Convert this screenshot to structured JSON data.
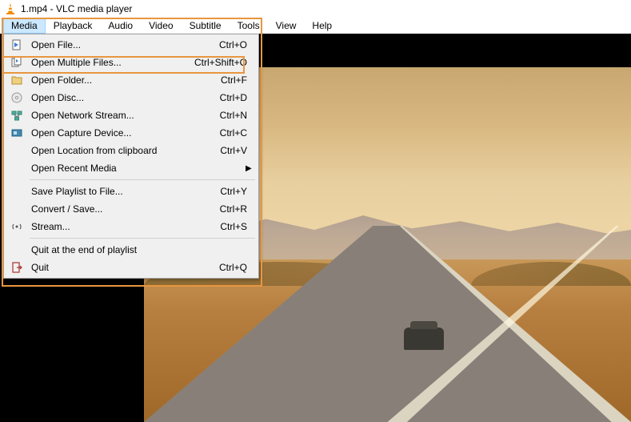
{
  "titlebar": {
    "text": "1.mp4 - VLC media player"
  },
  "menubar": {
    "items": [
      {
        "label": "Media",
        "active": true
      },
      {
        "label": "Playback"
      },
      {
        "label": "Audio"
      },
      {
        "label": "Video"
      },
      {
        "label": "Subtitle"
      },
      {
        "label": "Tools"
      },
      {
        "label": "View"
      },
      {
        "label": "Help"
      }
    ]
  },
  "dropdown": {
    "groups": [
      [
        {
          "icon": "file-icon",
          "label": "Open File...",
          "shortcut": "Ctrl+O"
        },
        {
          "icon": "files-icon",
          "label": "Open Multiple Files...",
          "shortcut": "Ctrl+Shift+O",
          "highlighted": true
        },
        {
          "icon": "folder-icon",
          "label": "Open Folder...",
          "shortcut": "Ctrl+F"
        },
        {
          "icon": "disc-icon",
          "label": "Open Disc...",
          "shortcut": "Ctrl+D"
        },
        {
          "icon": "network-icon",
          "label": "Open Network Stream...",
          "shortcut": "Ctrl+N"
        },
        {
          "icon": "capture-icon",
          "label": "Open Capture Device...",
          "shortcut": "Ctrl+C"
        },
        {
          "icon": "",
          "label": "Open Location from clipboard",
          "shortcut": "Ctrl+V"
        },
        {
          "icon": "",
          "label": "Open Recent Media",
          "submenu": true
        }
      ],
      [
        {
          "icon": "",
          "label": "Save Playlist to File...",
          "shortcut": "Ctrl+Y"
        },
        {
          "icon": "",
          "label": "Convert / Save...",
          "shortcut": "Ctrl+R"
        },
        {
          "icon": "stream-icon",
          "label": "Stream...",
          "shortcut": "Ctrl+S"
        }
      ],
      [
        {
          "icon": "",
          "label": "Quit at the end of playlist"
        },
        {
          "icon": "quit-icon",
          "label": "Quit",
          "shortcut": "Ctrl+Q"
        }
      ]
    ]
  }
}
